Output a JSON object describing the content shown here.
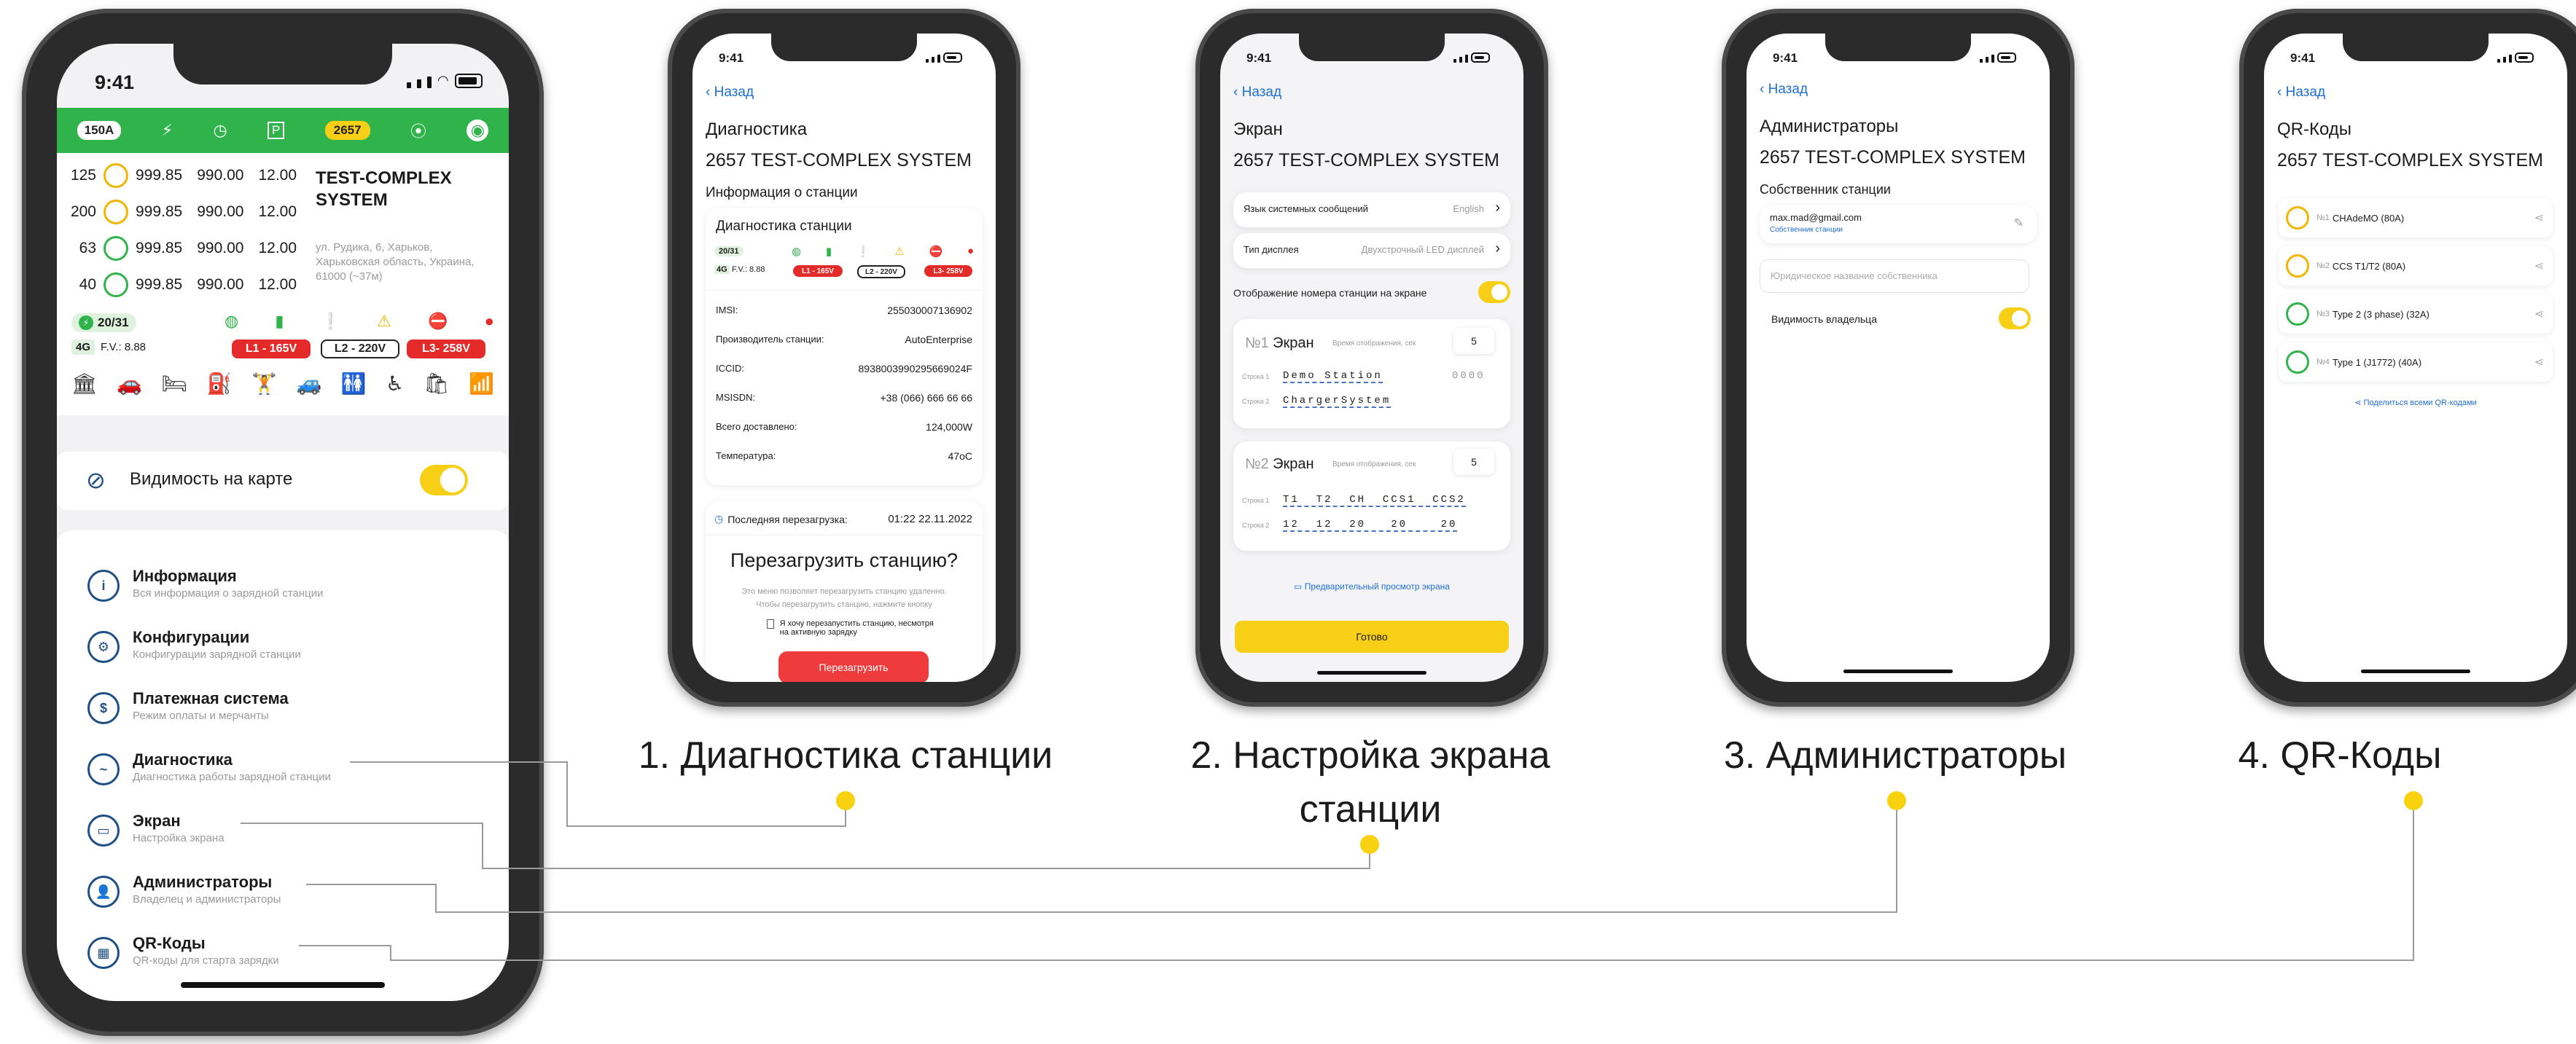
{
  "status_time": "9:41",
  "main": {
    "topbar": {
      "amp": "150A",
      "id": "2657"
    },
    "rows": [
      {
        "n": "125",
        "a": "999.85",
        "b": "990.00",
        "c": "12.00"
      },
      {
        "n": "200",
        "a": "999.85",
        "b": "990.00",
        "c": "12.00"
      },
      {
        "n": "63",
        "a": "999.85",
        "b": "990.00",
        "c": "12.00"
      },
      {
        "n": "40",
        "a": "999.85",
        "b": "990.00",
        "c": "12.00"
      }
    ],
    "station_name": "TEST-COMPLEX SYSTEM",
    "address": "ул. Рудика, 6, Харьков, Харьковская область, Украина, 61000 (~37м)",
    "ports": "20/31",
    "net": "4G",
    "fw": "F.V.: 8.88",
    "l1": "L1 - 165V",
    "l2": "L2 - 220V",
    "l3": "L3- 258V",
    "visibility_label": "Видимость на карте",
    "menu": [
      {
        "title": "Информация",
        "sub": "Вся информация о зарядной станции",
        "icon": "i"
      },
      {
        "title": "Конфигурации",
        "sub": "Конфигурации зарядной станции",
        "icon": "⚙"
      },
      {
        "title": "Платежная система",
        "sub": "Режим оплаты и мерчанты",
        "icon": "$"
      },
      {
        "title": "Диагностика",
        "sub": "Диагностика работы зарядной станции",
        "icon": "~"
      },
      {
        "title": "Экран",
        "sub": "Настройка экрана",
        "icon": "▭"
      },
      {
        "title": "Администраторы",
        "sub": "Владелец и администраторы",
        "icon": "👤"
      },
      {
        "title": "QR-Коды",
        "sub": "QR-коды для старта зарядки",
        "icon": "▦"
      }
    ]
  },
  "back_label": "Назад",
  "station_title": "2657 TEST-COMPLEX SYSTEM",
  "diag": {
    "title": "Диагностика",
    "section": "Информация о станции",
    "card_title": "Диагностика станции",
    "ports": "20/31",
    "net": "4G",
    "fw": "F.V.: 8.88",
    "l1": "L1 - 165V",
    "l2": "L2 - 220V",
    "l3": "L3- 258V",
    "rows": [
      {
        "k": "IMSI:",
        "v": "255030007136902"
      },
      {
        "k": "Производитель станции:",
        "v": "AutoEnterprise"
      },
      {
        "k": "ICCID:",
        "v": "8938003990295669024F"
      },
      {
        "k": "MSISDN:",
        "v": "+38 (066) 666 66 66"
      },
      {
        "k": "Всего доставлено:",
        "v": "124,000W"
      },
      {
        "k": "Температура:",
        "v": "47oC"
      }
    ],
    "last_reboot_label": "Последняя перезагрузка:",
    "last_reboot_value": "01:22  22.11.2022",
    "reboot_question": "Перезагрузить станцию?",
    "reboot_hint1": "Это меню позволяет перезагрузить станцию удаленно.",
    "reboot_hint2": "Чтобы перезагрузить станцию, нажмите кнопку",
    "checkbox_label": "Я хочу перезапустить станцию, несмотря на активную зарядку",
    "reboot_button": "Перезагрузить"
  },
  "screen_cfg": {
    "title": "Экран",
    "lang_label": "Язык системных сообщений",
    "lang_value": "English",
    "display_label": "Тип дисплея",
    "display_value": "Двухстрочный LED дисплей",
    "show_number_label": "Отображение номера станции на экране",
    "s1_num": "№1",
    "s1_title": "Экран",
    "s1_time_label": "Время отображения, сек",
    "s1_time": "5",
    "s1_row1_label": "Строка 1",
    "s1_row1": "Demo  Station",
    "s1_row1_tail": "0000",
    "s1_row2_label": "Строка 2",
    "s1_row2": "ChargerSystem",
    "s2_num": "№2",
    "s2_title": "Экран",
    "s2_time_label": "Время отображения, сек",
    "s2_time": "5",
    "s2_row1_label": "Строка 1",
    "s2_row1": "T1  T2  CH  CCS1  CCS2",
    "s2_row2_label": "Строка 2",
    "s2_row2": "12  12  20   20    20",
    "preview_label": "Предварительный просмотр экрана",
    "done_button": "Готово"
  },
  "admins": {
    "title": "Администраторы",
    "owner_section": "Собственник станции",
    "email": "max.mad@gmail.com",
    "email_sub": "Собственник станции",
    "legal_placeholder": "Юридическое название собственника",
    "visibility_label": "Видимость владельца"
  },
  "qr": {
    "title": "QR-Коды",
    "items": [
      {
        "num": "№1",
        "name": "CHAdeMO (80A)"
      },
      {
        "num": "№2",
        "name": "CCS T1/T2 (80A)"
      },
      {
        "num": "№3",
        "name": "Type 2 (3 phase) (32A)"
      },
      {
        "num": "№4",
        "name": "Type 1 (J1772) (40A)"
      }
    ],
    "share_all": "Поделиться всеми QR-кодами"
  },
  "captions": {
    "c1": "1. Диагностика станции",
    "c2a": "2. Настройка экрана",
    "c2b": "станции",
    "c3": "3. Администраторы",
    "c4": "4. QR-Коды"
  },
  "colors": {
    "accent_green": "#2fb34a",
    "accent_yellow": "#f7cf16",
    "link_blue": "#1e6fd6",
    "red": "#e52a2a"
  }
}
